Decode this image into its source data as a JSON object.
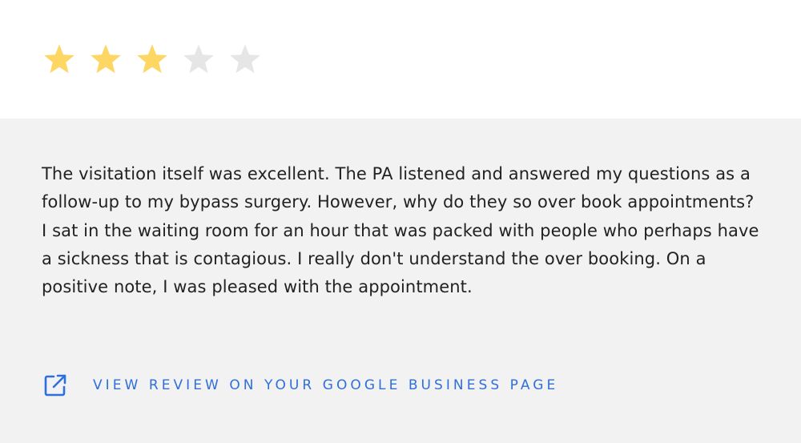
{
  "rating": {
    "value": 3,
    "max": 5,
    "filled_color": "#fdd663",
    "empty_color": "#e6e6e6"
  },
  "review": {
    "text": "The visitation itself was excellent. The PA listened and answered my questions as a follow-up to my bypass surgery. However, why do they so over book appointments? I sat in the waiting room for an hour that was packed with people who perhaps have a sickness that is contagious. I really don't understand the over booking. On a positive note, I was pleased with the appointment."
  },
  "link": {
    "label": "VIEW REVIEW ON YOUR GOOGLE BUSINESS PAGE",
    "icon": "external-link-icon",
    "color": "#2f6fdb"
  }
}
